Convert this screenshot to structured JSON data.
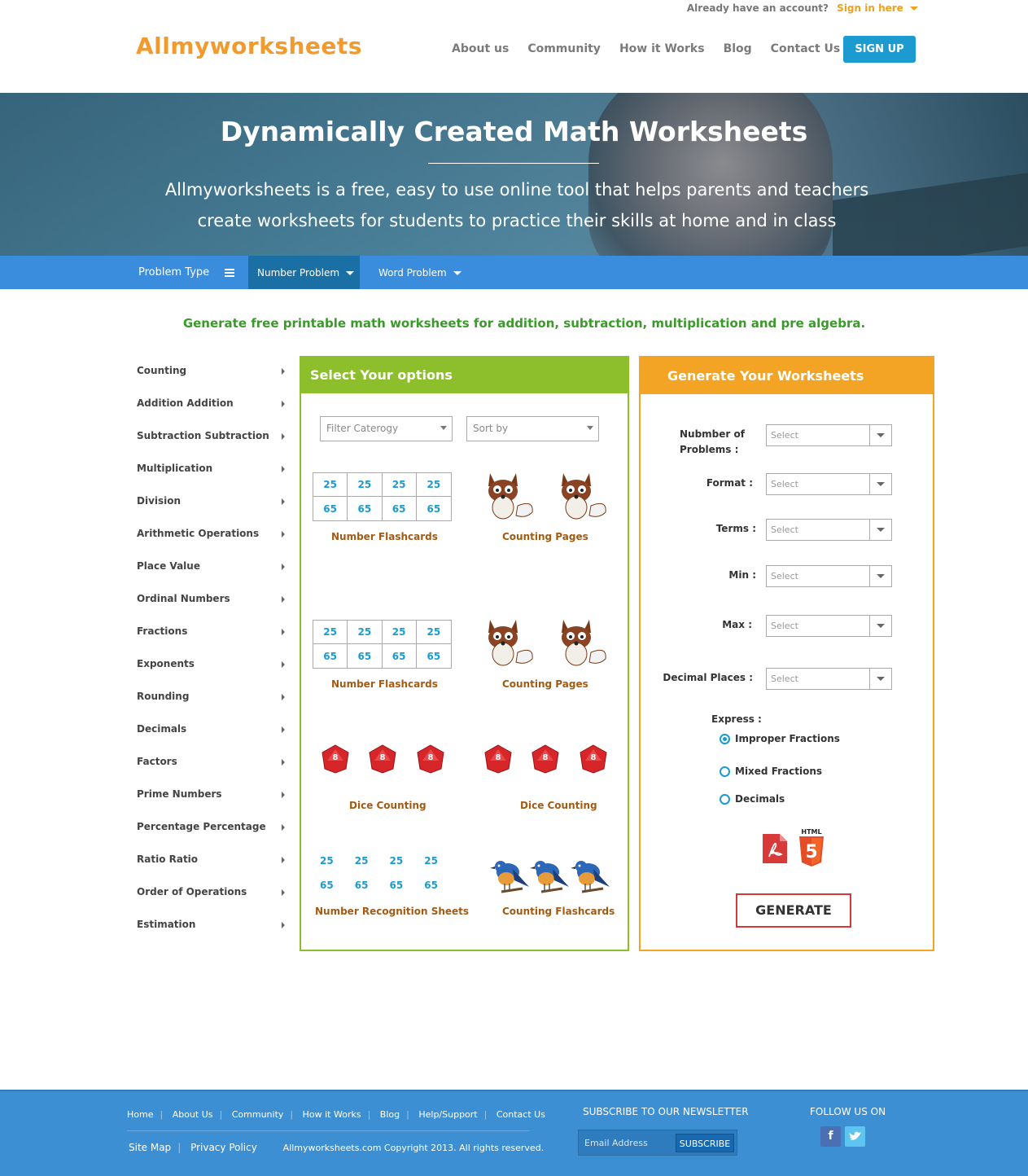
{
  "header": {
    "account_prompt": "Already have an account?",
    "signin_label": "Sign in here",
    "logo": "Allmyworksheets",
    "nav": [
      "About us",
      "Community",
      "How it Works",
      "Blog",
      "Contact Us"
    ],
    "signup_label": "SIGN UP"
  },
  "hero": {
    "title": "Dynamically Created Math Worksheets",
    "description": "Allmyworksheets is a free, easy to use online tool that helps parents and teachers create worksheets for students to practice their skills at home and in class"
  },
  "problem_bar": {
    "label": "Problem Type",
    "tab_number": "Number Problem",
    "tab_word": "Word Problem"
  },
  "tagline": "Generate free printable math worksheets for addition, subtraction, multiplication and pre algebra.",
  "sidebar": {
    "items": [
      "Counting",
      "Addition Addition",
      "Subtraction Subtraction",
      "Multiplication",
      "Division",
      "Arithmetic Operations",
      "Place Value",
      "Ordinal Numbers",
      "Fractions",
      "Exponents",
      "Rounding",
      "Decimals",
      "Factors",
      "Prime Numbers",
      "Percentage Percentage",
      "Ratio Ratio",
      "Order of Operations",
      "Estimation"
    ]
  },
  "options": {
    "title": "Select Your options",
    "filter_placeholder": "Filter Caterogy",
    "sort_placeholder": "Sort by",
    "grid_top": [
      "25",
      "25",
      "25",
      "25"
    ],
    "grid_bottom": [
      "65",
      "65",
      "65",
      "65"
    ],
    "dice_value": "8",
    "cards": [
      "Number Flashcards",
      "Counting Pages",
      "Number Flashcards",
      "Counting Pages",
      "Dice Counting",
      "Dice Counting",
      "Number Recognition Sheets",
      "Counting Flashcards"
    ]
  },
  "generate": {
    "title": "Generate Your Worksheets",
    "labels": {
      "num_problems": "Nubmber of Problems :",
      "format": "Format :",
      "terms": "Terms :",
      "min": "Min :",
      "max": "Max :",
      "decimal_places": "Decimal Places :",
      "express": "Express :"
    },
    "select_placeholder": "Select",
    "radio_options": [
      "Improper Fractions",
      "Mixed Fractions",
      "Decimals"
    ],
    "selected_radio": "Improper Fractions",
    "html5_label": "HTML",
    "html5_number": "5",
    "button": "GENERATE"
  },
  "footer": {
    "links": [
      "Home",
      "About Us",
      "Community",
      "How it Works",
      "Blog",
      "Help/Support",
      "Contact Us"
    ],
    "separator": "|",
    "site_map": "Site Map",
    "privacy": "Privacy Policy",
    "copyright": "Allmyworksheets.com Copyright 2013. All rights reserved.",
    "newsletter_title": "SUBSCRIBE TO OUR NEWSLETTER",
    "email_placeholder": "Email Address",
    "subscribe": "SUBSCRIBE",
    "follow_title": "FOLLOW US ON",
    "facebook_glyph": "f"
  },
  "colors": {
    "logo": "#f39a2c",
    "signup": "#1b9bcf",
    "bar": "#3a8ddc",
    "options_accent": "#8dbf2c",
    "generate_accent": "#f4a425",
    "footer": "#3d8fd3"
  }
}
